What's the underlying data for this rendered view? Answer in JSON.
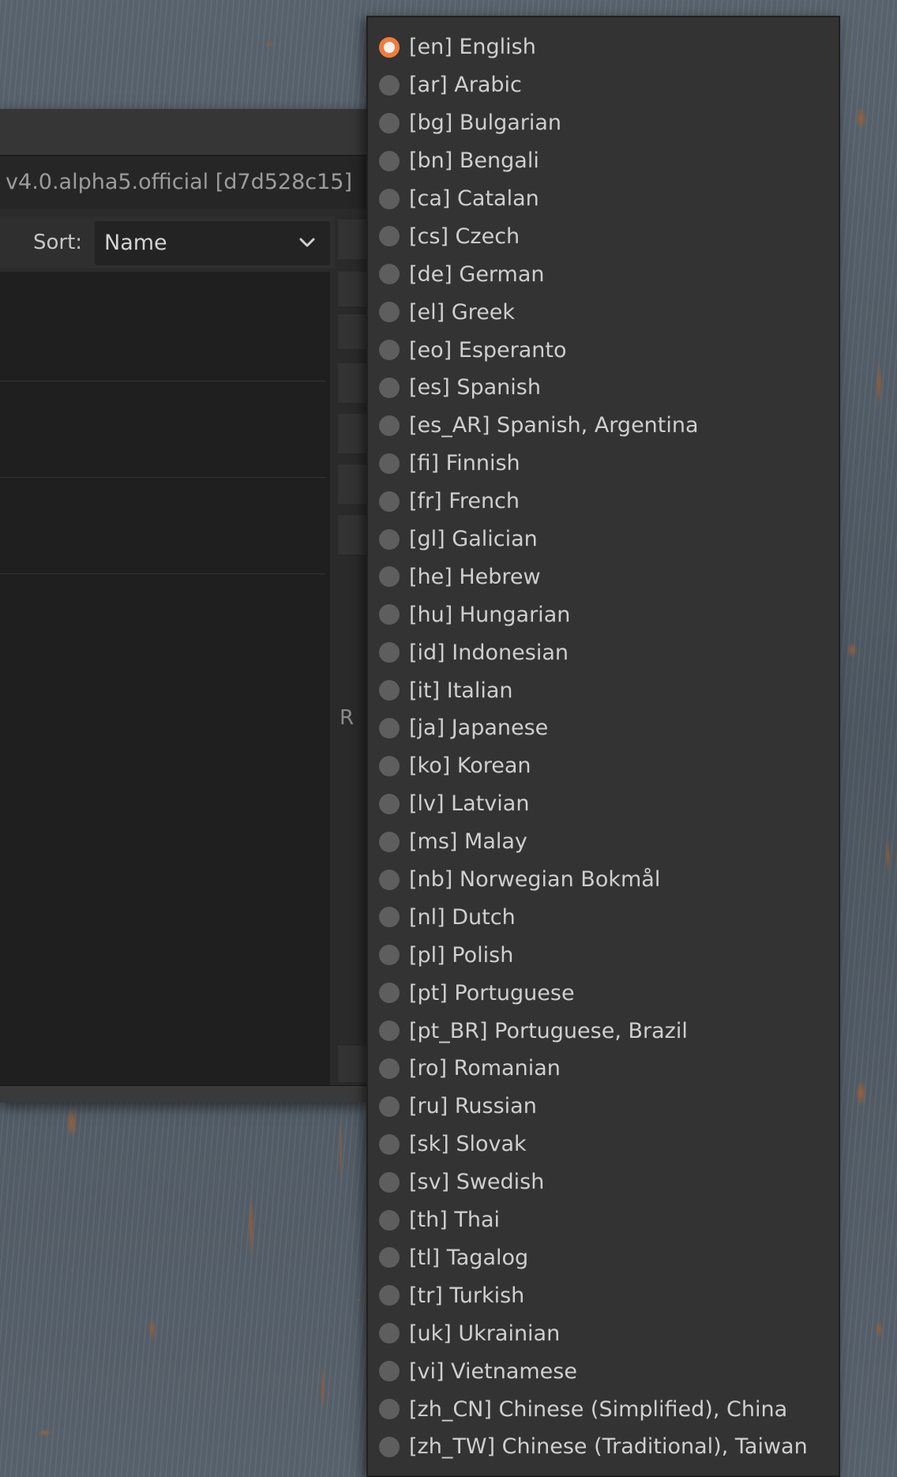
{
  "app": {
    "version": "v4.0.alpha5.official [d7d528c15]",
    "sort_label": "Sort:",
    "sort_value": "Name",
    "partial_column_letter": "R"
  },
  "language_menu": {
    "selected": "en",
    "accent_color": "#f07c3c",
    "items": [
      {
        "code": "en",
        "label": "[en] English",
        "checked": true
      },
      {
        "code": "ar",
        "label": "[ar] Arabic"
      },
      {
        "code": "bg",
        "label": "[bg] Bulgarian"
      },
      {
        "code": "bn",
        "label": "[bn] Bengali"
      },
      {
        "code": "ca",
        "label": "[ca] Catalan"
      },
      {
        "code": "cs",
        "label": "[cs] Czech"
      },
      {
        "code": "de",
        "label": "[de] German"
      },
      {
        "code": "el",
        "label": "[el] Greek"
      },
      {
        "code": "eo",
        "label": "[eo] Esperanto"
      },
      {
        "code": "es",
        "label": "[es] Spanish"
      },
      {
        "code": "es_AR",
        "label": "[es_AR] Spanish, Argentina"
      },
      {
        "code": "fi",
        "label": "[fi] Finnish"
      },
      {
        "code": "fr",
        "label": "[fr] French"
      },
      {
        "code": "gl",
        "label": "[gl] Galician"
      },
      {
        "code": "he",
        "label": "[he] Hebrew"
      },
      {
        "code": "hu",
        "label": "[hu] Hungarian"
      },
      {
        "code": "id",
        "label": "[id] Indonesian"
      },
      {
        "code": "it",
        "label": "[it] Italian"
      },
      {
        "code": "ja",
        "label": "[ja] Japanese"
      },
      {
        "code": "ko",
        "label": "[ko] Korean"
      },
      {
        "code": "lv",
        "label": "[lv] Latvian"
      },
      {
        "code": "ms",
        "label": "[ms] Malay"
      },
      {
        "code": "nb",
        "label": "[nb] Norwegian Bokmål"
      },
      {
        "code": "nl",
        "label": "[nl] Dutch"
      },
      {
        "code": "pl",
        "label": "[pl] Polish"
      },
      {
        "code": "pt",
        "label": "[pt] Portuguese"
      },
      {
        "code": "pt_BR",
        "label": "[pt_BR] Portuguese, Brazil"
      },
      {
        "code": "ro",
        "label": "[ro] Romanian"
      },
      {
        "code": "ru",
        "label": "[ru] Russian"
      },
      {
        "code": "sk",
        "label": "[sk] Slovak"
      },
      {
        "code": "sv",
        "label": "[sv] Swedish"
      },
      {
        "code": "th",
        "label": "[th] Thai"
      },
      {
        "code": "tl",
        "label": "[tl] Tagalog"
      },
      {
        "code": "tr",
        "label": "[tr] Turkish"
      },
      {
        "code": "uk",
        "label": "[uk] Ukrainian"
      },
      {
        "code": "vi",
        "label": "[vi] Vietnamese"
      },
      {
        "code": "zh_CN",
        "label": "[zh_CN] Chinese (Simplified), China"
      },
      {
        "code": "zh_TW",
        "label": "[zh_TW] Chinese (Traditional), Taiwan"
      }
    ]
  }
}
